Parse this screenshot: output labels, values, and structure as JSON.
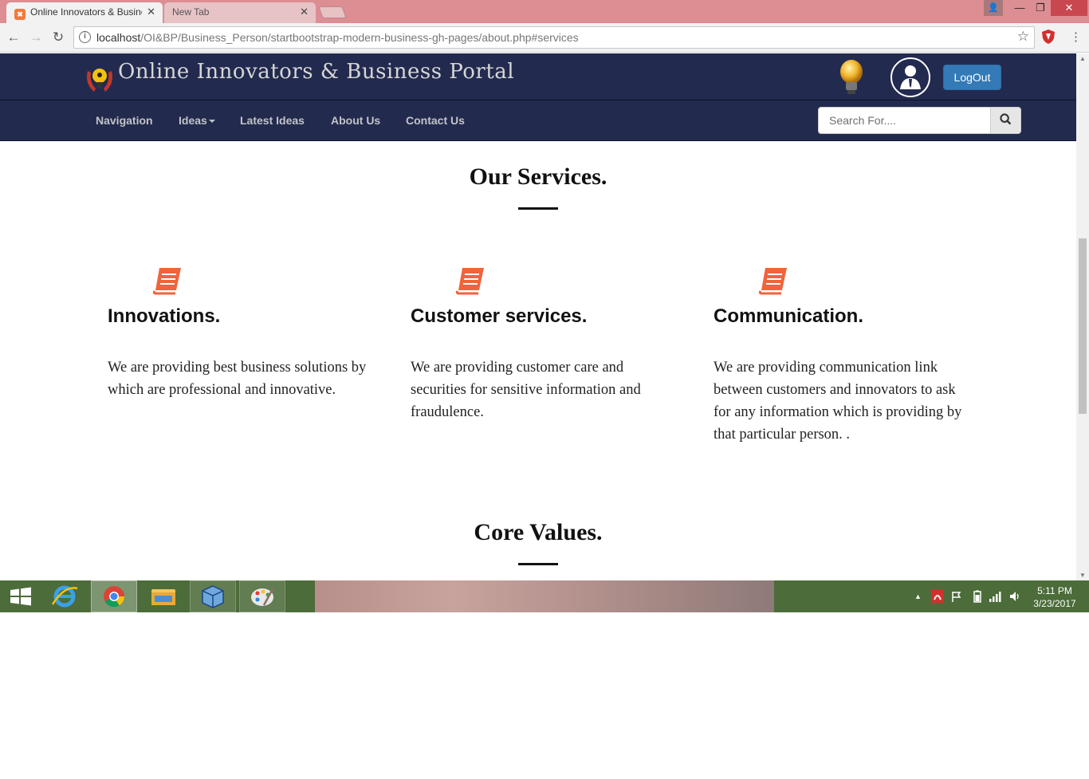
{
  "browser": {
    "tabs": [
      {
        "label": "Online Innovators & Business Portal",
        "active": true
      },
      {
        "label": "New Tab",
        "active": false
      }
    ],
    "url_host": "localhost",
    "url_path": "/OI&BP/Business_Person/startbootstrap-modern-business-gh-pages/about.php#services"
  },
  "header": {
    "site_name": "Online Innovators & Business Portal",
    "logout_label": "LogOut"
  },
  "nav": {
    "items": [
      "Navigation",
      "Ideas",
      "Latest Ideas",
      "About Us",
      "Contact Us"
    ],
    "search_placeholder": "Search For...."
  },
  "services": {
    "title": "Our Services.",
    "items": [
      {
        "title": "Innovations.",
        "text": "We are providing best business solutions by which are professional and innovative."
      },
      {
        "title": "Customer services.",
        "text": "We are providing customer care and securities for sensitive information and fraudulence."
      },
      {
        "title": "Communication.",
        "text": "We are providing communication link between customers and innovators to ask for any information which is providing by that particular person. ."
      }
    ]
  },
  "core_values": {
    "title": "Core Values."
  },
  "taskbar": {
    "time": "5:11 PM",
    "date": "3/23/2017",
    "apps": [
      "windows-start",
      "internet-explorer",
      "chrome",
      "file-explorer",
      "virtualbox",
      "paint"
    ]
  },
  "colors": {
    "navbar_bg": "#232a4f",
    "accent_icon": "#f0643c",
    "logout_btn": "#337ab7",
    "taskbar": "#4c6c3a",
    "tabbar": "#dc8e93"
  }
}
